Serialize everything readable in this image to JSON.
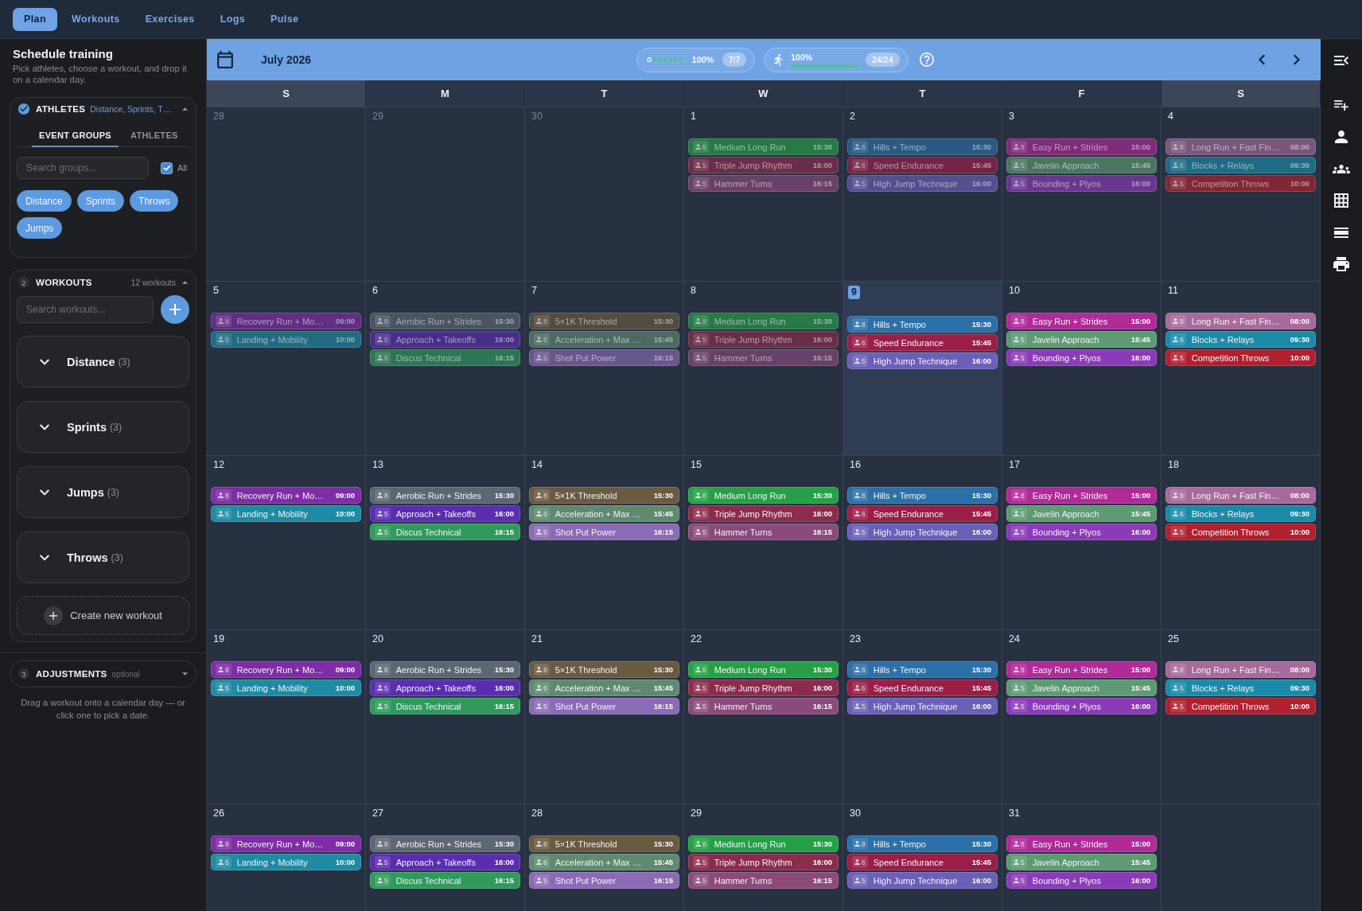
{
  "nav": {
    "tabs": [
      {
        "label": "Plan",
        "selected": true
      },
      {
        "label": "Workouts",
        "selected": false
      },
      {
        "label": "Exercises",
        "selected": false
      },
      {
        "label": "Logs",
        "selected": false
      },
      {
        "label": "Pulse",
        "selected": false
      }
    ]
  },
  "sidebar": {
    "title": "Schedule training",
    "subtitle": "Pick athletes, choose a workout, and drop it on a calendar day.",
    "athletes": {
      "checked": true,
      "title": "ATHLETES",
      "summary": "Distance, Sprints, T…",
      "expanded": true,
      "tabs": [
        {
          "label": "EVENT GROUPS",
          "selected": true
        },
        {
          "label": "ATHLETES",
          "selected": false
        }
      ],
      "search": {
        "placeholder": "Search groups..."
      },
      "all": {
        "label": "All",
        "checked": true
      },
      "groups": [
        {
          "label": "Distance",
          "selected": true
        },
        {
          "label": "Sprints",
          "selected": true
        },
        {
          "label": "Throws",
          "selected": true
        },
        {
          "label": "Jumps",
          "selected": true
        }
      ]
    },
    "workouts": {
      "step": "2",
      "title": "WORKOUTS",
      "count": "12 workouts",
      "expanded": true,
      "search": {
        "placeholder": "Search workouts..."
      },
      "categories": [
        {
          "name": "Distance",
          "count": "(3)",
          "expanded": false
        },
        {
          "name": "Sprints",
          "count": "(3)",
          "expanded": false
        },
        {
          "name": "Jumps",
          "count": "(3)",
          "expanded": false
        },
        {
          "name": "Throws",
          "count": "(3)",
          "expanded": false
        }
      ],
      "create_label": "Create new workout"
    },
    "adjustments": {
      "step": "3",
      "title": "ADJUSTMENTS",
      "note": "optional",
      "expanded": false
    },
    "hint": "Drag a workout onto a calendar day — or click one to pick a date."
  },
  "calendar": {
    "month": "July 2026",
    "progress": [
      {
        "kind": "dots",
        "value": "100%",
        "count": "7/7"
      },
      {
        "kind": "bar",
        "value": "100%",
        "count": "24/24",
        "level": 1
      }
    ],
    "weekdays": [
      {
        "label": "S",
        "weekend": true
      },
      {
        "label": "M",
        "weekend": false
      },
      {
        "label": "T",
        "weekend": false
      },
      {
        "label": "W",
        "weekend": false
      },
      {
        "label": "T",
        "weekend": false
      },
      {
        "label": "F",
        "weekend": false
      },
      {
        "label": "S",
        "weekend": true
      }
    ],
    "weeks": [
      {
        "days": [
          {
            "date": "28",
            "kind": "outside"
          },
          {
            "date": "29",
            "kind": "outside"
          },
          {
            "date": "30",
            "kind": "outside"
          },
          {
            "date": "1",
            "kind": "past",
            "events": [
              {
                "count": "8",
                "name": "Medium Long Run",
                "time": "15:30",
                "color": "#277945"
              },
              {
                "count": "5",
                "name": "Triple Jump Rhythm",
                "time": "16:00",
                "color": "#692e48"
              },
              {
                "count": "5",
                "name": "Hammer Turns",
                "time": "16:15",
                "color": "#684168"
              }
            ]
          },
          {
            "date": "2",
            "kind": "past",
            "events": [
              {
                "count": "8",
                "name": "Hills + Tempo",
                "time": "15:30",
                "color": "#2a5a84"
              },
              {
                "count": "6",
                "name": "Speed Endurance",
                "time": "15:45",
                "color": "#722546"
              },
              {
                "count": "5",
                "name": "High Jump Technique",
                "time": "16:00",
                "color": "#544f8f"
              }
            ]
          },
          {
            "date": "3",
            "kind": "past",
            "events": [
              {
                "count": "8",
                "name": "Easy Run + Strides",
                "time": "15:00",
                "color": "#802c7a"
              },
              {
                "count": "5",
                "name": "Javelin Approach",
                "time": "15:45",
                "color": "#4b7562"
              },
              {
                "count": "5",
                "name": "Bounding + Plyos",
                "time": "16:00",
                "color": "#68378f"
              }
            ]
          },
          {
            "date": "4",
            "kind": "past",
            "events": [
              {
                "count": "8",
                "name": "Long Run + Fast Fin…",
                "time": "08:00",
                "color": "#7b567c"
              },
              {
                "count": "6",
                "name": "Blocks + Relays",
                "time": "09:30",
                "color": "#206b84"
              },
              {
                "count": "5",
                "name": "Competition Throws",
                "time": "10:00",
                "color": "#802635"
              }
            ]
          }
        ]
      },
      {
        "days": [
          {
            "date": "5",
            "kind": "past",
            "events": [
              {
                "count": "8",
                "name": "Recovery Run + Mo…",
                "time": "09:00",
                "color": "#602e83"
              },
              {
                "count": "5",
                "name": "Landing + Mobility",
                "time": "10:00",
                "color": "#226b81"
              }
            ]
          },
          {
            "date": "6",
            "kind": "past",
            "events": [
              {
                "count": "8",
                "name": "Aerobic Run + Strides",
                "time": "15:30",
                "color": "#4a5362"
              },
              {
                "count": "5",
                "name": "Approach + Takeoffs",
                "time": "16:00",
                "color": "#492e89"
              },
              {
                "count": "5",
                "name": "Discus Technical",
                "time": "16:15",
                "color": "#2d7553"
              }
            ]
          },
          {
            "date": "7",
            "kind": "past",
            "events": [
              {
                "count": "8",
                "name": "5×1K Threshold",
                "time": "15:30",
                "color": "#534c41"
              },
              {
                "count": "6",
                "name": "Acceleration + Max …",
                "time": "15:45",
                "color": "#4c6b60"
              },
              {
                "count": "5",
                "name": "Shot Put Power",
                "time": "16:15",
                "color": "#68578d"
              }
            ]
          },
          {
            "date": "8",
            "kind": "past",
            "events": [
              {
                "count": "8",
                "name": "Medium Long Run",
                "time": "15:30",
                "color": "#277945"
              },
              {
                "count": "5",
                "name": "Triple Jump Rhythm",
                "time": "16:00",
                "color": "#692e48"
              },
              {
                "count": "5",
                "name": "Hammer Turns",
                "time": "16:15",
                "color": "#684168"
              }
            ]
          },
          {
            "date": "9",
            "kind": "today",
            "events": [
              {
                "count": "8",
                "name": "Hills + Tempo",
                "time": "15:30",
                "color": "#2b70a8"
              },
              {
                "count": "6",
                "name": "Speed Endurance",
                "time": "15:45",
                "color": "#9a1e48"
              },
              {
                "count": "5",
                "name": "High Jump Technique",
                "time": "16:00",
                "color": "#6b60b8"
              }
            ]
          },
          {
            "date": "10",
            "kind": "future",
            "events": [
              {
                "count": "8",
                "name": "Easy Run + Strides",
                "time": "15:00",
                "color": "#b02a98"
              },
              {
                "count": "5",
                "name": "Javelin Approach",
                "time": "15:45",
                "color": "#5e9a74"
              },
              {
                "count": "5",
                "name": "Bounding + Plyos",
                "time": "16:00",
                "color": "#8b3bb8"
              }
            ]
          },
          {
            "date": "11",
            "kind": "future",
            "events": [
              {
                "count": "8",
                "name": "Long Run + Fast Fin…",
                "time": "08:00",
                "color": "#a86a9c"
              },
              {
                "count": "6",
                "name": "Blocks + Relays",
                "time": "09:30",
                "color": "#1b8aa8"
              },
              {
                "count": "5",
                "name": "Competition Throws",
                "time": "10:00",
                "color": "#b0202e"
              }
            ]
          }
        ]
      },
      {
        "days": [
          {
            "date": "12",
            "kind": "future",
            "events": [
              {
                "count": "8",
                "name": "Recovery Run + Mo…",
                "time": "09:00",
                "color": "#7e2da6"
              },
              {
                "count": "5",
                "name": "Landing + Mobility",
                "time": "10:00",
                "color": "#1e8aa3"
              }
            ]
          },
          {
            "date": "13",
            "kind": "future",
            "events": [
              {
                "count": "8",
                "name": "Aerobic Run + Strides",
                "time": "15:30",
                "color": "#5d6673"
              },
              {
                "count": "5",
                "name": "Approach + Takeoffs",
                "time": "16:00",
                "color": "#5a2db0"
              },
              {
                "count": "5",
                "name": "Discus Technical",
                "time": "16:15",
                "color": "#2f9a5c"
              }
            ]
          },
          {
            "date": "14",
            "kind": "future",
            "events": [
              {
                "count": "8",
                "name": "5×1K Threshold",
                "time": "15:30",
                "color": "#6a5a40"
              },
              {
                "count": "6",
                "name": "Acceleration + Max …",
                "time": "15:45",
                "color": "#5f8a70"
              },
              {
                "count": "5",
                "name": "Shot Put Power",
                "time": "16:15",
                "color": "#8a6bb5"
              }
            ]
          },
          {
            "date": "15",
            "kind": "future",
            "events": [
              {
                "count": "8",
                "name": "Medium Long Run",
                "time": "15:30",
                "color": "#26a047"
              },
              {
                "count": "5",
                "name": "Triple Jump Rhythm",
                "time": "16:00",
                "color": "#8c2c4c"
              },
              {
                "count": "5",
                "name": "Hammer Turns",
                "time": "16:15",
                "color": "#8b4a7c"
              }
            ]
          },
          {
            "date": "16",
            "kind": "future",
            "events": [
              {
                "count": "8",
                "name": "Hills + Tempo",
                "time": "15:30",
                "color": "#2b70a8"
              },
              {
                "count": "6",
                "name": "Speed Endurance",
                "time": "15:45",
                "color": "#9a1e48"
              },
              {
                "count": "5",
                "name": "High Jump Technique",
                "time": "16:00",
                "color": "#6b60b8"
              }
            ]
          },
          {
            "date": "17",
            "kind": "future",
            "events": [
              {
                "count": "8",
                "name": "Easy Run + Strides",
                "time": "15:00",
                "color": "#b02a98"
              },
              {
                "count": "5",
                "name": "Javelin Approach",
                "time": "15:45",
                "color": "#5e9a74"
              },
              {
                "count": "5",
                "name": "Bounding + Plyos",
                "time": "16:00",
                "color": "#8b3bb8"
              }
            ]
          },
          {
            "date": "18",
            "kind": "future",
            "events": [
              {
                "count": "8",
                "name": "Long Run + Fast Fin…",
                "time": "08:00",
                "color": "#a86a9c"
              },
              {
                "count": "6",
                "name": "Blocks + Relays",
                "time": "09:30",
                "color": "#1b8aa8"
              },
              {
                "count": "5",
                "name": "Competition Throws",
                "time": "10:00",
                "color": "#b0202e"
              }
            ]
          }
        ]
      },
      {
        "days": [
          {
            "date": "19",
            "kind": "future",
            "events": [
              {
                "count": "8",
                "name": "Recovery Run + Mo…",
                "time": "09:00",
                "color": "#7e2da6"
              },
              {
                "count": "5",
                "name": "Landing + Mobility",
                "time": "10:00",
                "color": "#1e8aa3"
              }
            ]
          },
          {
            "date": "20",
            "kind": "future",
            "events": [
              {
                "count": "8",
                "name": "Aerobic Run + Strides",
                "time": "15:30",
                "color": "#5d6673"
              },
              {
                "count": "5",
                "name": "Approach + Takeoffs",
                "time": "16:00",
                "color": "#5a2db0"
              },
              {
                "count": "5",
                "name": "Discus Technical",
                "time": "16:15",
                "color": "#2f9a5c"
              }
            ]
          },
          {
            "date": "21",
            "kind": "future",
            "events": [
              {
                "count": "8",
                "name": "5×1K Threshold",
                "time": "15:30",
                "color": "#6a5a40"
              },
              {
                "count": "6",
                "name": "Acceleration + Max …",
                "time": "15:45",
                "color": "#5f8a70"
              },
              {
                "count": "5",
                "name": "Shot Put Power",
                "time": "16:15",
                "color": "#8a6bb5"
              }
            ]
          },
          {
            "date": "22",
            "kind": "future",
            "events": [
              {
                "count": "8",
                "name": "Medium Long Run",
                "time": "15:30",
                "color": "#26a047"
              },
              {
                "count": "5",
                "name": "Triple Jump Rhythm",
                "time": "16:00",
                "color": "#8c2c4c"
              },
              {
                "count": "5",
                "name": "Hammer Turns",
                "time": "16:15",
                "color": "#8b4a7c"
              }
            ]
          },
          {
            "date": "23",
            "kind": "future",
            "events": [
              {
                "count": "8",
                "name": "Hills + Tempo",
                "time": "15:30",
                "color": "#2b70a8"
              },
              {
                "count": "6",
                "name": "Speed Endurance",
                "time": "15:45",
                "color": "#9a1e48"
              },
              {
                "count": "5",
                "name": "High Jump Technique",
                "time": "16:00",
                "color": "#6b60b8"
              }
            ]
          },
          {
            "date": "24",
            "kind": "future",
            "events": [
              {
                "count": "8",
                "name": "Easy Run + Strides",
                "time": "15:00",
                "color": "#b02a98"
              },
              {
                "count": "5",
                "name": "Javelin Approach",
                "time": "15:45",
                "color": "#5e9a74"
              },
              {
                "count": "5",
                "name": "Bounding + Plyos",
                "time": "16:00",
                "color": "#8b3bb8"
              }
            ]
          },
          {
            "date": "25",
            "kind": "future",
            "events": [
              {
                "count": "8",
                "name": "Long Run + Fast Fin…",
                "time": "08:00",
                "color": "#a86a9c"
              },
              {
                "count": "6",
                "name": "Blocks + Relays",
                "time": "09:30",
                "color": "#1b8aa8"
              },
              {
                "count": "5",
                "name": "Competition Throws",
                "time": "10:00",
                "color": "#b0202e"
              }
            ]
          }
        ]
      },
      {
        "days": [
          {
            "date": "26",
            "kind": "future",
            "events": [
              {
                "count": "8",
                "name": "Recovery Run + Mo…",
                "time": "09:00",
                "color": "#7e2da6"
              },
              {
                "count": "5",
                "name": "Landing + Mobility",
                "time": "10:00",
                "color": "#1e8aa3"
              }
            ]
          },
          {
            "date": "27",
            "kind": "future",
            "events": [
              {
                "count": "8",
                "name": "Aerobic Run + Strides",
                "time": "15:30",
                "color": "#5d6673"
              },
              {
                "count": "5",
                "name": "Approach + Takeoffs",
                "time": "16:00",
                "color": "#5a2db0"
              },
              {
                "count": "5",
                "name": "Discus Technical",
                "time": "16:15",
                "color": "#2f9a5c"
              }
            ]
          },
          {
            "date": "28",
            "kind": "future",
            "events": [
              {
                "count": "8",
                "name": "5×1K Threshold",
                "time": "15:30",
                "color": "#6a5a40"
              },
              {
                "count": "6",
                "name": "Acceleration + Max …",
                "time": "15:45",
                "color": "#5f8a70"
              },
              {
                "count": "5",
                "name": "Shot Put Power",
                "time": "16:15",
                "color": "#8a6bb5"
              }
            ]
          },
          {
            "date": "29",
            "kind": "future",
            "events": [
              {
                "count": "8",
                "name": "Medium Long Run",
                "time": "15:30",
                "color": "#26a047"
              },
              {
                "count": "5",
                "name": "Triple Jump Rhythm",
                "time": "16:00",
                "color": "#8c2c4c"
              },
              {
                "count": "5",
                "name": "Hammer Turns",
                "time": "16:15",
                "color": "#8b4a7c"
              }
            ]
          },
          {
            "date": "30",
            "kind": "future",
            "events": [
              {
                "count": "8",
                "name": "Hills + Tempo",
                "time": "15:30",
                "color": "#2b70a8"
              },
              {
                "count": "6",
                "name": "Speed Endurance",
                "time": "15:45",
                "color": "#9a1e48"
              },
              {
                "count": "5",
                "name": "High Jump Technique",
                "time": "16:00",
                "color": "#6b60b8"
              }
            ]
          },
          {
            "date": "31",
            "kind": "future",
            "events": [
              {
                "count": "8",
                "name": "Easy Run + Strides",
                "time": "15:00",
                "color": "#b02a98"
              },
              {
                "count": "5",
                "name": "Javelin Approach",
                "time": "15:45",
                "color": "#5e9a74"
              },
              {
                "count": "5",
                "name": "Bounding + Plyos",
                "time": "16:00",
                "color": "#8b3bb8"
              }
            ]
          }
        ]
      }
    ]
  }
}
